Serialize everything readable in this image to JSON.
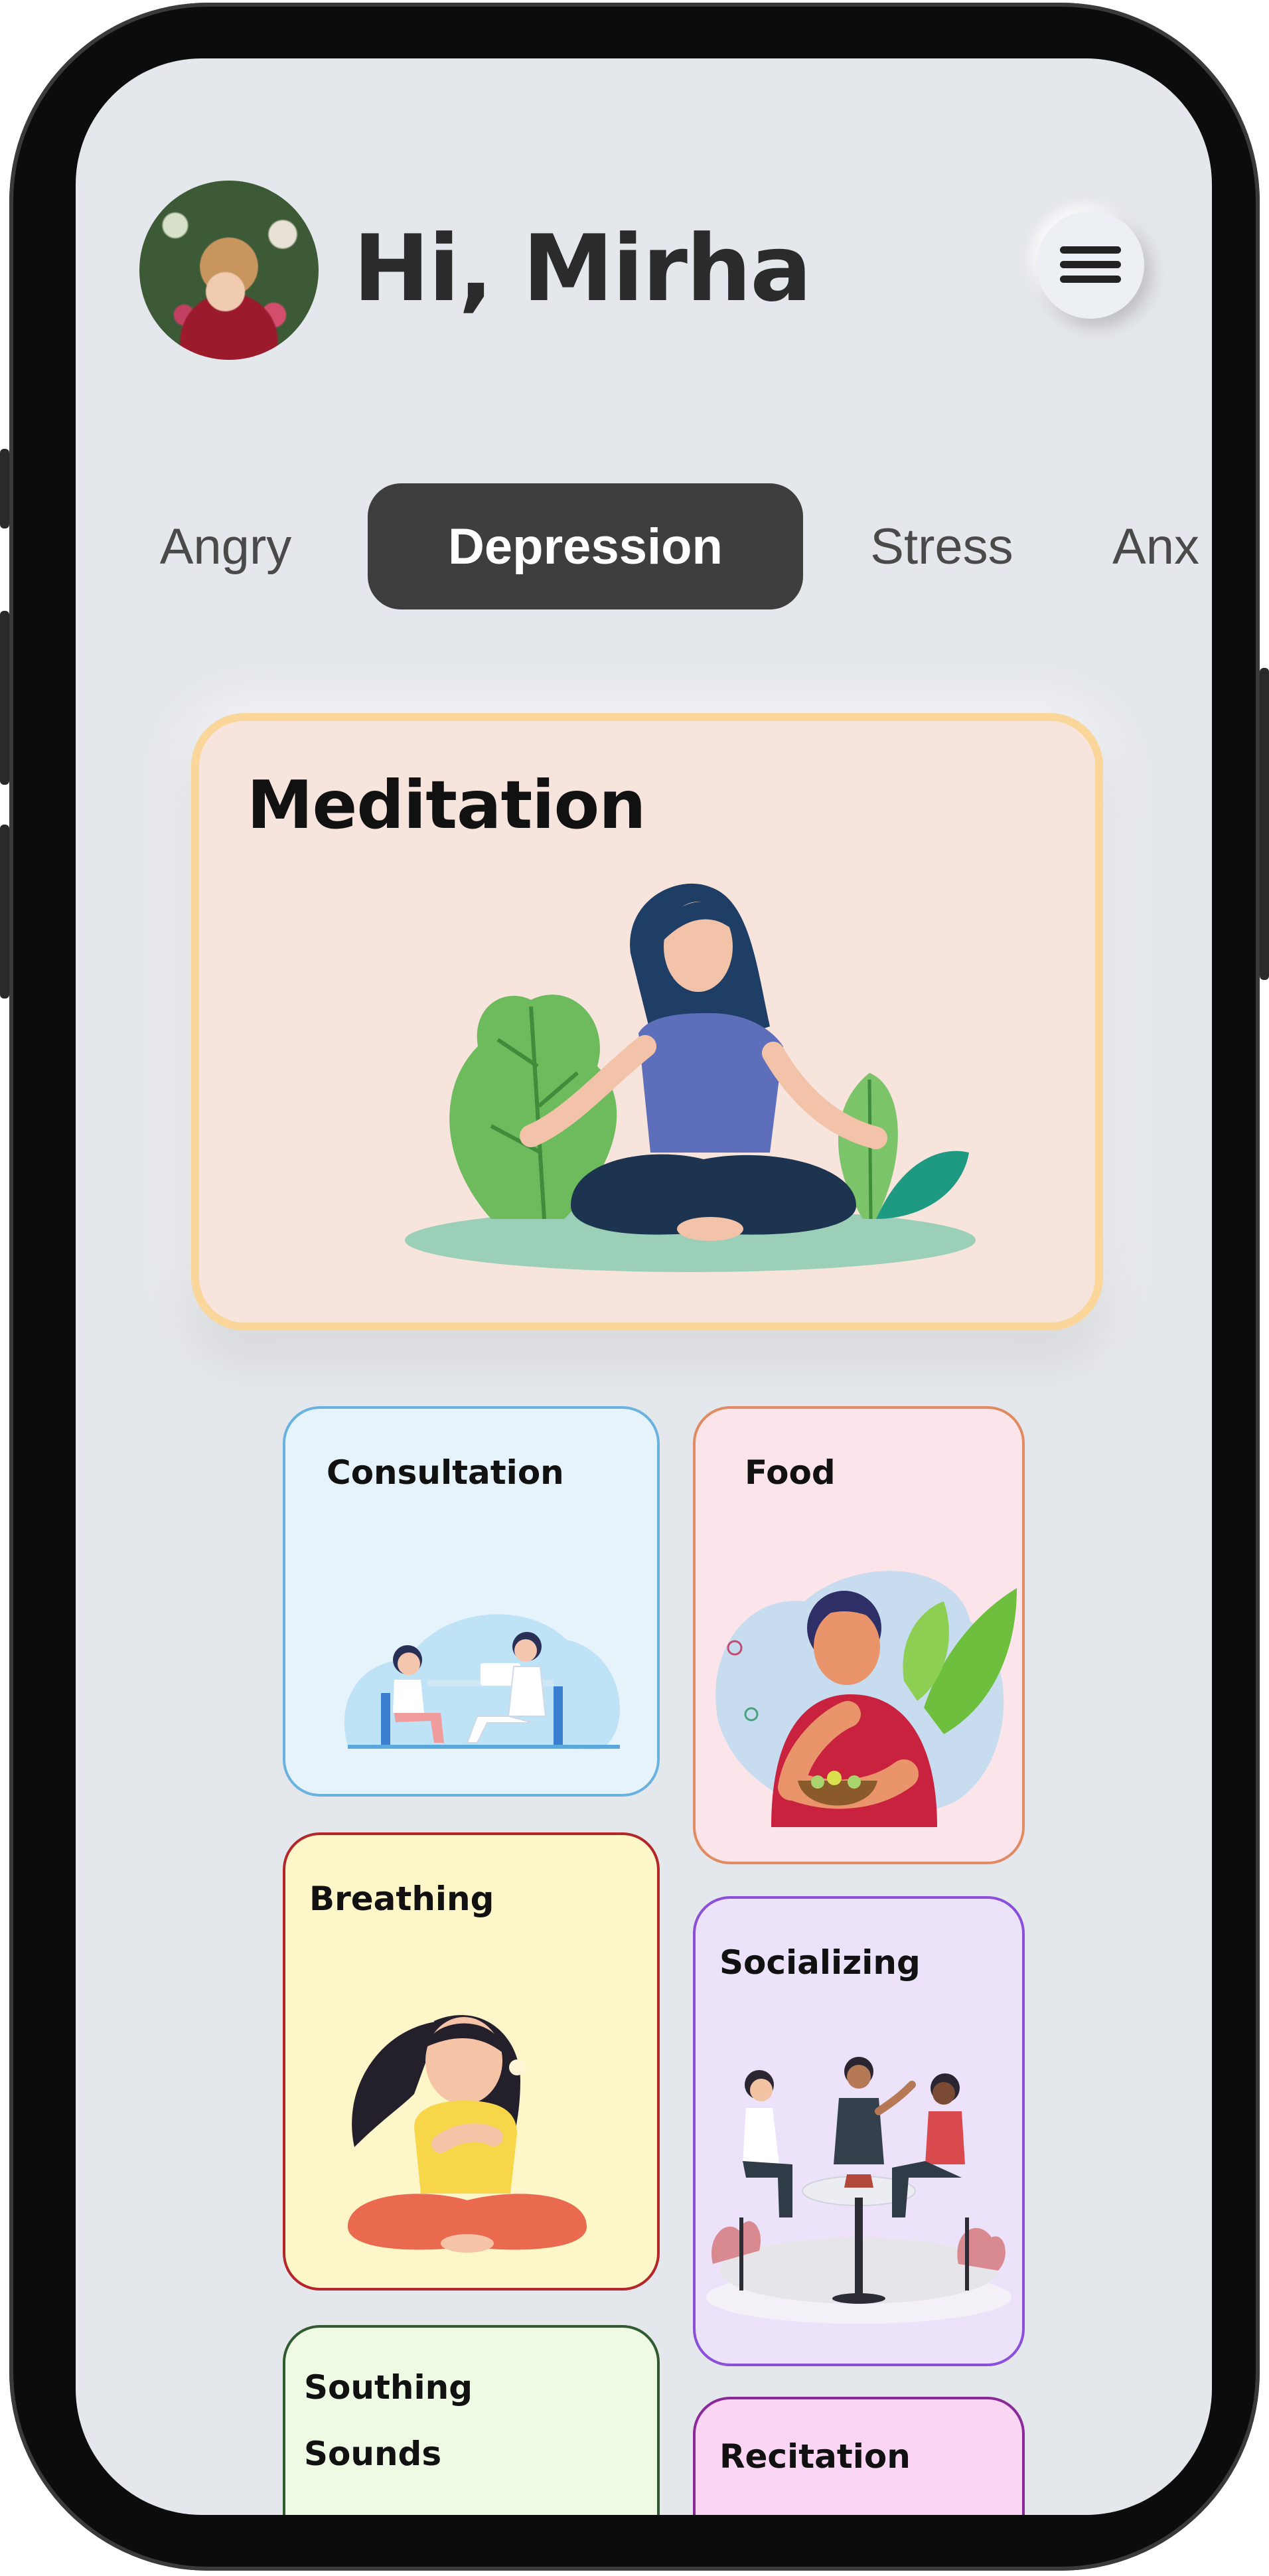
{
  "header": {
    "greeting": "Hi, Mirha",
    "avatar_alt": "Mirha"
  },
  "menu": {
    "icon": "hamburger-menu-icon"
  },
  "tabs": [
    {
      "label": "Angry",
      "active": false
    },
    {
      "label": "Depression",
      "active": true
    },
    {
      "label": "Stress",
      "active": false
    },
    {
      "label": "Anx",
      "active": false
    }
  ],
  "featured": {
    "title": "Meditation",
    "illustration": "meditating-woman-illustration"
  },
  "cards": [
    {
      "title": "Consultation",
      "illustration": "doctor-consultation-illustration",
      "background": "#e6f3fb",
      "border": "#6ab3df"
    },
    {
      "title": "Food",
      "illustration": "man-eating-salad-illustration",
      "background": "#fbe4ea",
      "border": "#e08b62"
    },
    {
      "title": "Breathing",
      "illustration": "woman-breathing-illustration",
      "background": "#fdf6c8",
      "border": "#b3272b"
    },
    {
      "title": "Socializing",
      "illustration": "friends-at-cafe-illustration",
      "background": "#ece3fb",
      "border": "#8c4fd9"
    },
    {
      "title_line1": "Southing",
      "title_line2": "Sounds",
      "background": "#eefae4",
      "border": "#2f5b2f"
    },
    {
      "title": "Recitation",
      "background": "#fad6f4",
      "border": "#8a2a98"
    }
  ],
  "colors": {
    "screen": "#e4e7ec",
    "active_tab": "#3e3e3e",
    "featured_bg": "#f7e4dc",
    "featured_border": "#fad69a"
  }
}
